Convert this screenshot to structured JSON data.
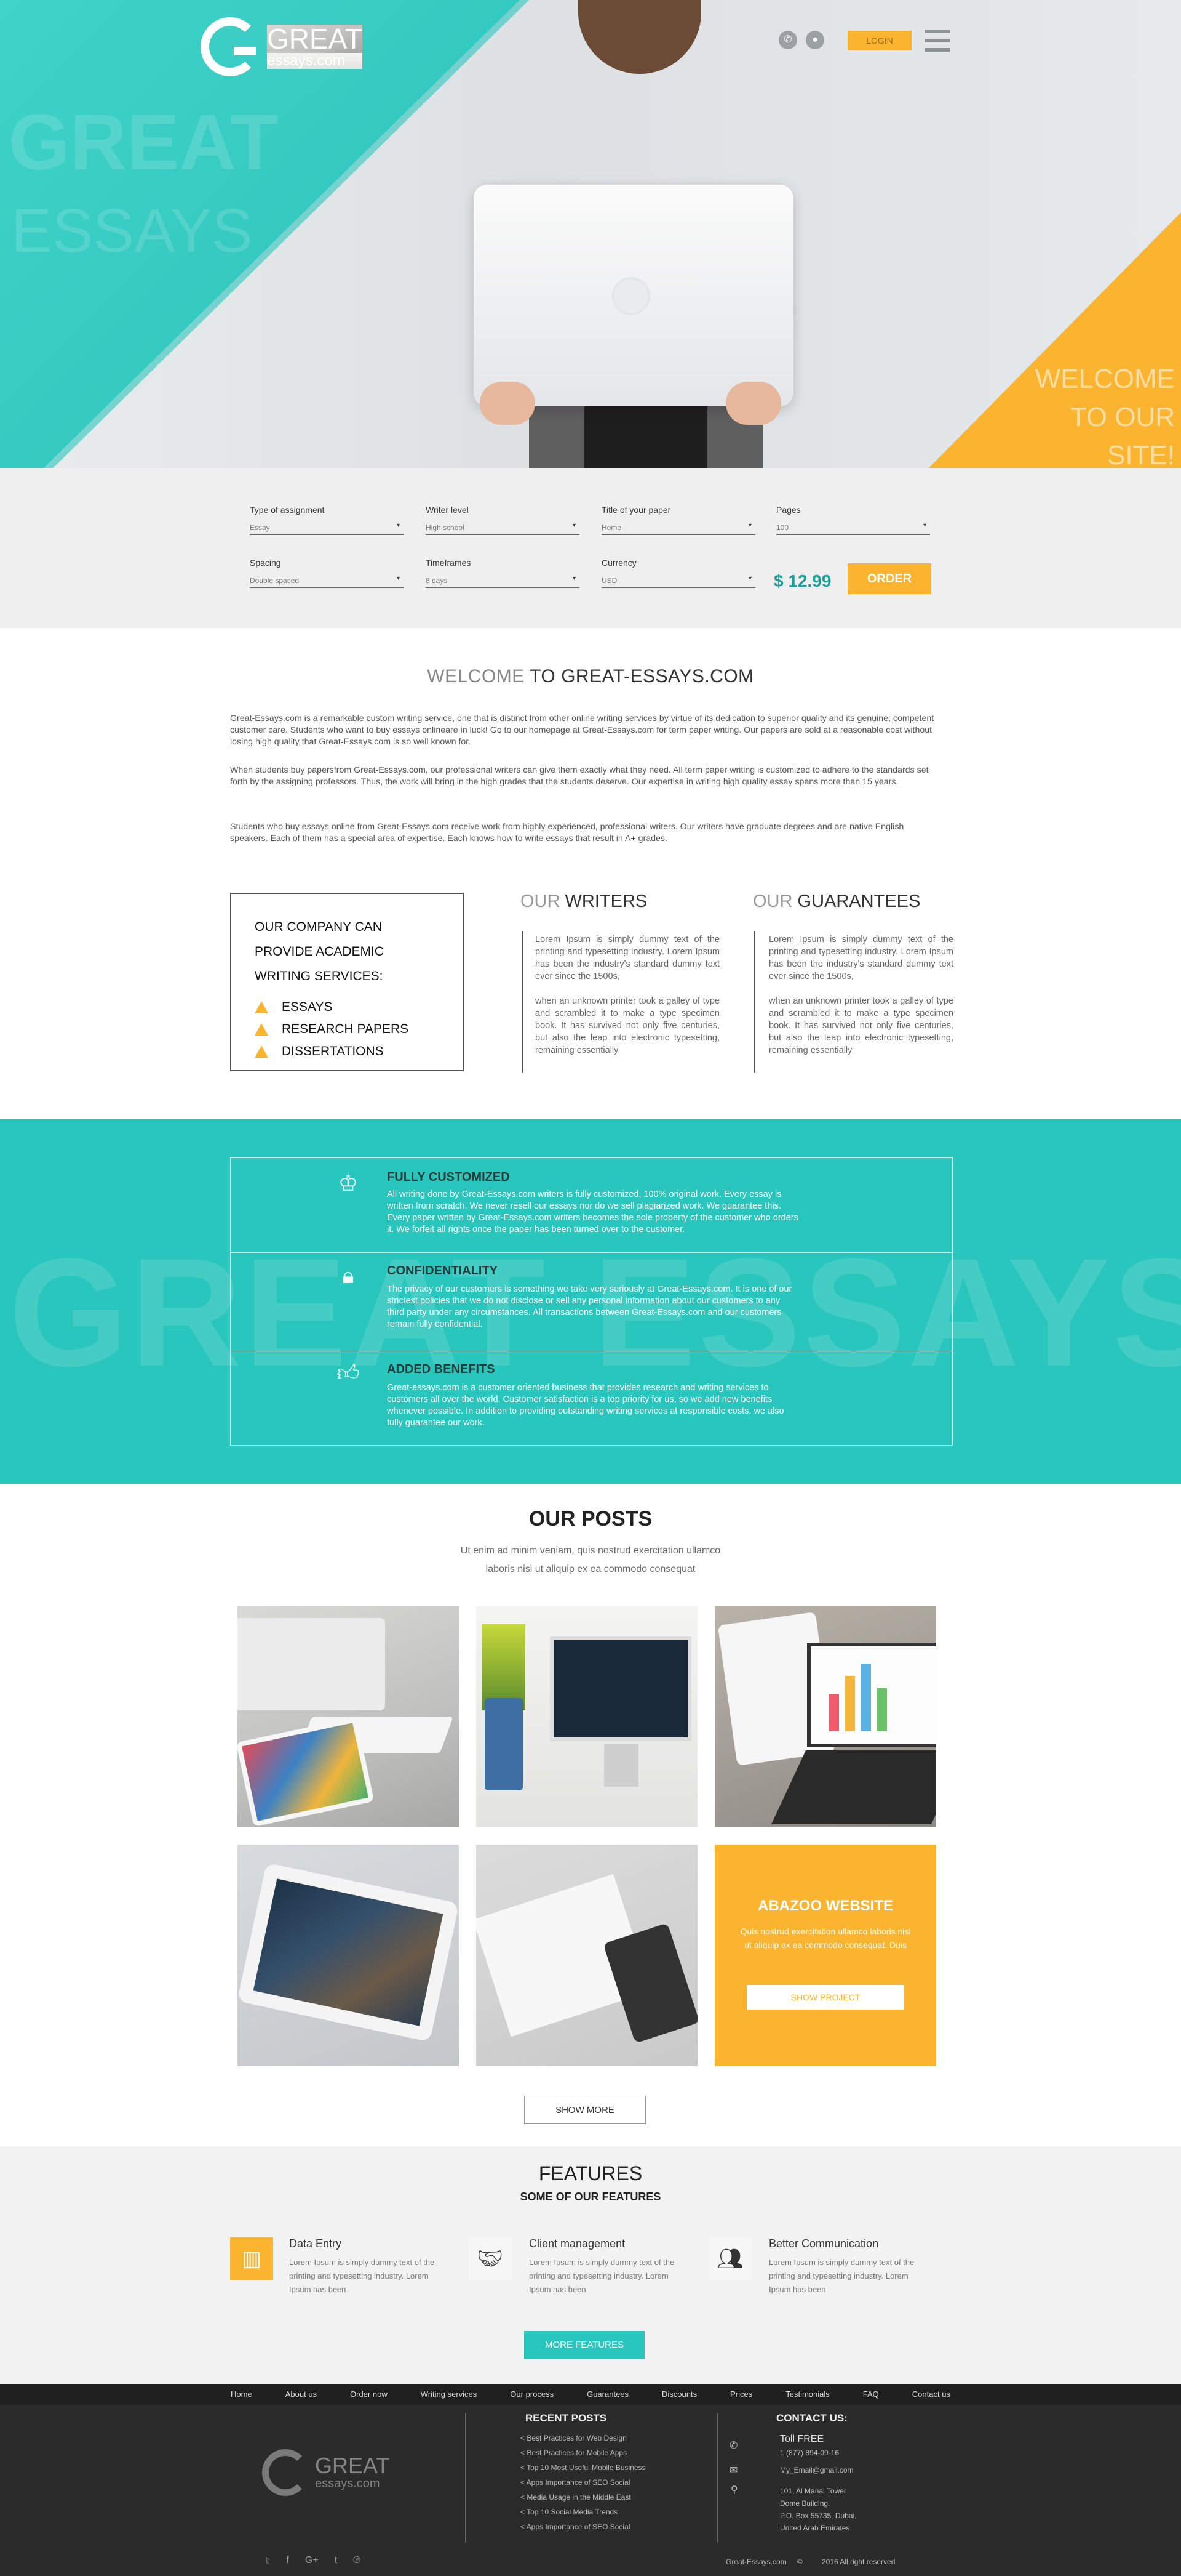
{
  "brand": {
    "name": "GREAT",
    "sub": "essays.com"
  },
  "hero": {
    "ghost1": "GREAT",
    "ghost2": "ESSAYS",
    "login": "LOGIN",
    "welcome1": "WELCOME",
    "welcome2": "TO OUR SITE!"
  },
  "order": {
    "type_lbl": "Type of assignment",
    "type_val": "Essay",
    "level_lbl": "Writer level",
    "level_val": "High school",
    "title_lbl": "Title of your paper",
    "title_val": "Home",
    "pages_lbl": "Pages",
    "pages_val": "100",
    "spacing_lbl": "Spacing",
    "spacing_val": "Double spaced",
    "time_lbl": "Timeframes",
    "time_val": "8 days",
    "cur_lbl": "Currency",
    "cur_val": "USD",
    "price": "$ 12.99",
    "button": "ORDER"
  },
  "welcome": {
    "title_thin": "WELCOME",
    "title_bold": "TO GREAT-ESSAYS.COM",
    "p1": "Great-Essays.com is a remarkable custom writing service, one that is distinct from other online writing services by virtue of its dedication to superior quality and its genuine, competent customer care. Students who want to buy essays onlineare in luck! Go to our homepage at Great-Essays.com for term paper writing. Our papers are sold at a reasonable cost without losing high quality that Great-Essays.com is so well known for.",
    "p2": "When students buy papersfrom Great-Essays.com, our professional writers can give them exactly what they need. All term paper writing is customized to adhere to the standards set forth by the assigning professors. Thus, the work will bring in the high grades that the students deserve. Our expertise in writing high quality essay spans more than 15 years.",
    "p3": "Students who buy essays online from Great-Essays.com receive work from highly experienced, professional writers. Our writers have graduate degrees and are native English speakers. Each of them has a special area of expertise. Each knows how to write essays that result in A+ grades."
  },
  "company": {
    "title": "OUR COMPANY CAN PROVIDE ACADEMIC WRITING SERVICES:",
    "items": [
      "ESSAYS",
      "RESEARCH PAPERS",
      "DISSERTATIONS"
    ]
  },
  "writers": {
    "thin": "OUR",
    "bold": "WRITERS",
    "p1": "Lorem Ipsum is simply dummy text of the printing and typesetting industry. Lorem Ipsum has been the industry's standard dummy text ever since the 1500s,",
    "p2": "when an unknown printer took a galley of type and scrambled it to make a type specimen book. It has survived not only five centuries, but also the leap into electronic typesetting, remaining essentially"
  },
  "guarantees": {
    "thin": "OUR",
    "bold": "GUARANTEES",
    "p1": "Lorem Ipsum is simply dummy text of the printing and typesetting industry. Lorem Ipsum has been the industry's standard dummy text ever since the 1500s,",
    "p2": "when an unknown printer took a galley of type and scrambled it to make a type specimen book. It has survived not only five centuries, but also the leap into electronic typesetting, remaining essentially"
  },
  "teal": {
    "ghost": "GREAT ESSAYS",
    "items": [
      {
        "head": "FULLY CUSTOMIZED",
        "body": "All writing done by Great-Essays.com writers is fully customized, 100% original work. Every essay is written from scratch. We never resell our essays nor do we sell plagiarized work. We guarantee this. Every paper written by Great-Essays.com writers becomes the sole property of the customer who orders it. We forfeit all rights once the paper has been turned over to the customer."
      },
      {
        "head": "CONFIDENTIALITY",
        "body": "The privacy of our customers is something we take very seriously at Great-Essays.com. It is one of our strictest policies that we do not disclose or sell any personal information about our customers to any third party under any circumstances. All transactions between Great-Essays.com and our customers remain fully confidential."
      },
      {
        "head": "ADDED BENEFITS",
        "body": "Great-essays.com is a customer oriented business that provides research and writing services to customers all over the world. Customer satisfaction is a top priority for us, so we add new benefits whenever possible. In addition to providing outstanding writing services at responsible costs, we also fully guarantee our work."
      }
    ]
  },
  "posts": {
    "title": "OUR POSTS",
    "sub1": "Ut enim ad minim veniam, quis nostrud exercitation ullamco",
    "sub2": "laboris nisi ut aliquip ex ea commodo consequat",
    "card_title": "ABAZOO WEBSITE",
    "card_text": "Quis nostrud exercitation ullamco laboris nisi ut aliquip ex ea commodo consequat. Duis",
    "card_btn": "SHOW PROJECT",
    "more": "SHOW MORE"
  },
  "features": {
    "title": "FEATURES",
    "sub": "SOME OF OUR FEATURES",
    "items": [
      {
        "head": "Data Entry",
        "text": "Lorem Ipsum is simply dummy text of the printing and typesetting industry. Lorem Ipsum has been"
      },
      {
        "head": "Client management",
        "text": "Lorem Ipsum is simply dummy text of the printing and typesetting industry. Lorem Ipsum has been"
      },
      {
        "head": "Better Communication",
        "text": "Lorem Ipsum is simply dummy text of the printing and typesetting industry. Lorem Ipsum has been"
      }
    ],
    "more": "MORE FEATURES"
  },
  "footer": {
    "nav": [
      "Home",
      "About us",
      "Order now",
      "Writing services",
      "Our process",
      "Guarantees",
      "Discounts",
      "Prices",
      "Testimonials",
      "FAQ",
      "Contact us"
    ],
    "recent_title": "RECENT POSTS",
    "recent": [
      "< Best Practices for Web Design",
      "< Best Practices for Mobile Apps",
      "< Top 10 Most Useful Mobile Business",
      "< Apps Importance of SEO Social",
      "< Media Usage in the Middle East",
      "< Top 10 Social Media Trends",
      "< Apps Importance of SEO Social"
    ],
    "contact_title": "CONTACT US:",
    "toll": "Toll FREE",
    "phone": "1 (877) 894-09-16",
    "email": "My_Email@gmail.com",
    "addr1": "101, Al Manal Tower",
    "addr2": "Dome Building,",
    "addr3": "P.O. Box 55735, Dubai,",
    "addr4": "United Arab Emirates",
    "site": "Great-Essays.com",
    "copy": "2016 All right reserved"
  }
}
